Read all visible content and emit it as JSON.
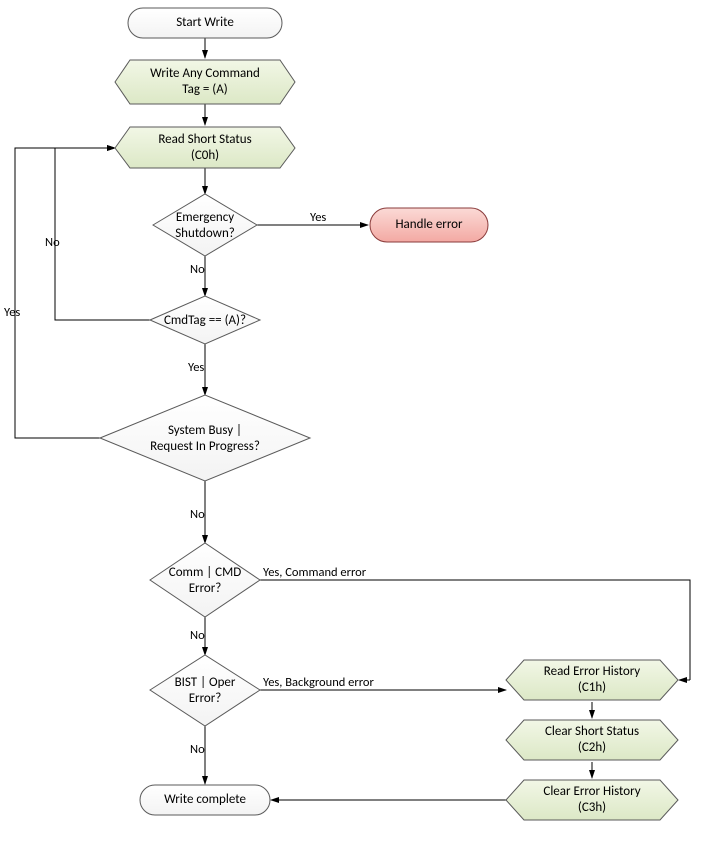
{
  "chart_data": {
    "type": "flowchart",
    "title": "",
    "nodes": [
      {
        "id": "start",
        "type": "terminator",
        "label": "Start Write"
      },
      {
        "id": "writecmd",
        "type": "process-hex",
        "label": "Write Any Command\nTag = (A)"
      },
      {
        "id": "readss",
        "type": "process-hex",
        "label": "Read Short Status\n(C0h)"
      },
      {
        "id": "emerg",
        "type": "decision",
        "label": "Emergency\nShutdown?"
      },
      {
        "id": "handleerr",
        "type": "terminator-error",
        "label": "Handle error"
      },
      {
        "id": "cmdtag",
        "type": "decision",
        "label": "CmdTag == (A)?"
      },
      {
        "id": "busy",
        "type": "decision",
        "label": "System Busy |\nRequest In Progress?"
      },
      {
        "id": "commerr",
        "type": "decision",
        "label": "Comm | CMD\nError?"
      },
      {
        "id": "bisterr",
        "type": "decision",
        "label": "BIST | Oper\nError?"
      },
      {
        "id": "complete",
        "type": "terminator",
        "label": "Write complete"
      },
      {
        "id": "rerrhist",
        "type": "process-hex",
        "label": "Read Error History\n(C1h)"
      },
      {
        "id": "clearss",
        "type": "process-hex",
        "label": "Clear Short Status\n(C2h)"
      },
      {
        "id": "clrerrhist",
        "type": "process-hex",
        "label": "Clear Error History\n(C3h)"
      }
    ],
    "edges": [
      {
        "from": "start",
        "to": "writecmd",
        "label": ""
      },
      {
        "from": "writecmd",
        "to": "readss",
        "label": ""
      },
      {
        "from": "readss",
        "to": "emerg",
        "label": ""
      },
      {
        "from": "emerg",
        "to": "handleerr",
        "label": "Yes"
      },
      {
        "from": "emerg",
        "to": "cmdtag",
        "label": "No"
      },
      {
        "from": "cmdtag",
        "to": "readss",
        "label": "No"
      },
      {
        "from": "cmdtag",
        "to": "busy",
        "label": "Yes"
      },
      {
        "from": "busy",
        "to": "readss",
        "label": "Yes"
      },
      {
        "from": "busy",
        "to": "commerr",
        "label": "No"
      },
      {
        "from": "commerr",
        "to": "rerrhist",
        "label": "Yes, Command error"
      },
      {
        "from": "commerr",
        "to": "bisterr",
        "label": "No"
      },
      {
        "from": "bisterr",
        "to": "rerrhist",
        "label": "Yes, Background error"
      },
      {
        "from": "bisterr",
        "to": "complete",
        "label": "No"
      },
      {
        "from": "rerrhist",
        "to": "clearss",
        "label": ""
      },
      {
        "from": "clearss",
        "to": "clrerrhist",
        "label": ""
      },
      {
        "from": "clrerrhist",
        "to": "complete",
        "label": ""
      }
    ]
  },
  "nodes": {
    "start": "Start Write",
    "writecmd_l1": "Write Any Command",
    "writecmd_l2": "Tag = (A)",
    "readss_l1": "Read Short Status",
    "readss_l2": "(C0h)",
    "emerg_l1": "Emergency",
    "emerg_l2": "Shutdown?",
    "handleerr": "Handle error",
    "cmdtag": "CmdTag == (A)?",
    "busy_l1": "System Busy |",
    "busy_l2": "Request In Progress?",
    "commerr_l1": "Comm | CMD",
    "commerr_l2": "Error?",
    "bisterr_l1": "BIST | Oper",
    "bisterr_l2": "Error?",
    "complete": "Write complete",
    "rerrhist_l1": "Read Error History",
    "rerrhist_l2": "(C1h)",
    "clearss_l1": "Clear Short Status",
    "clearss_l2": "(C2h)",
    "clrerrhist_l1": "Clear Error History",
    "clrerrhist_l2": "(C3h)"
  },
  "labels": {
    "yes": "Yes",
    "no": "No",
    "yes_cmd": "Yes, Command error",
    "yes_bg": "Yes, Background error"
  }
}
